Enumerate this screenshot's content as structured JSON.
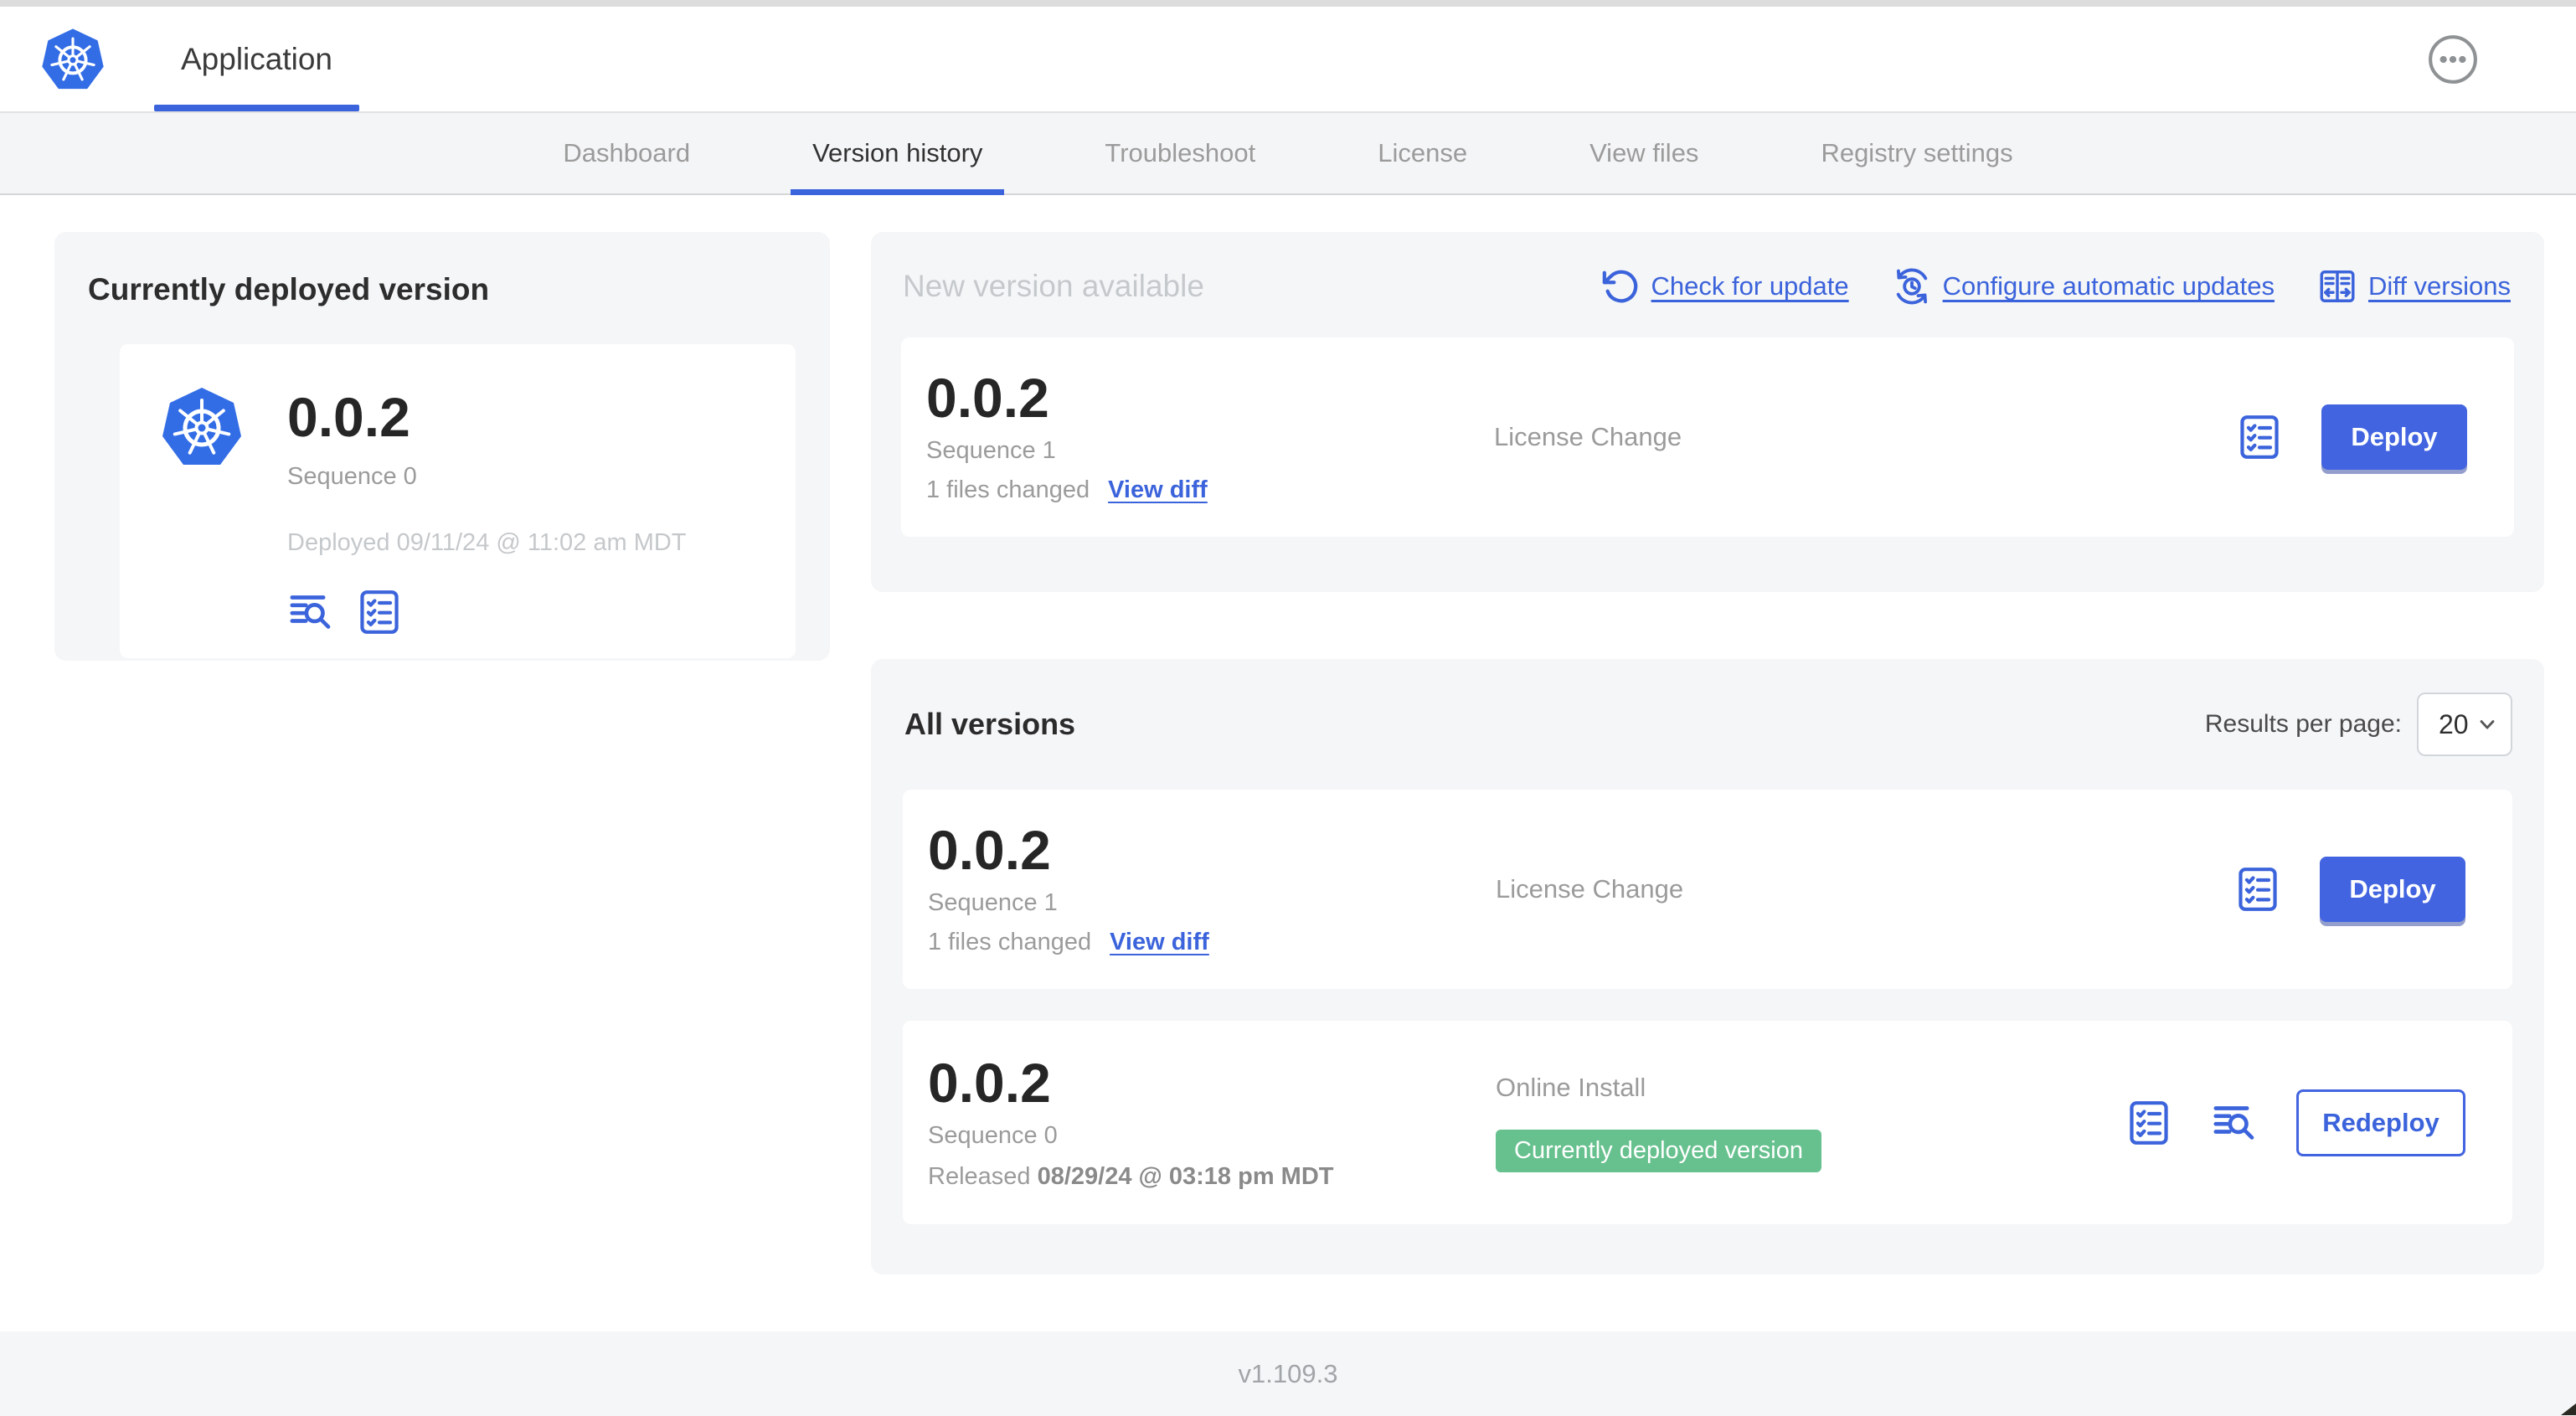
{
  "app": {
    "title": "Application"
  },
  "nav": {
    "tabs": [
      "Dashboard",
      "Version history",
      "Troubleshoot",
      "License",
      "View files",
      "Registry settings"
    ],
    "active": "Version history"
  },
  "current": {
    "section_title": "Currently deployed version",
    "version": "0.0.2",
    "sequence": "Sequence 0",
    "deployed": "Deployed 09/11/24 @ 11:02 am MDT"
  },
  "new_version": {
    "section_title": "New version available",
    "check_for_update": "Check for update",
    "configure_updates": "Configure automatic updates",
    "diff_versions": "Diff versions",
    "card": {
      "version": "0.0.2",
      "sequence": "Sequence 1",
      "files_changed": "1 files changed",
      "view_diff": "View diff",
      "release_notes": "License Change",
      "action": "Deploy"
    }
  },
  "all_versions": {
    "section_title": "All versions",
    "results_per_page_label": "Results per page:",
    "results_per_page": "20",
    "rows": [
      {
        "version": "0.0.2",
        "sequence": "Sequence 1",
        "files_changed": "1 files changed",
        "view_diff": "View diff",
        "release_notes": "License Change",
        "action": "Deploy"
      },
      {
        "version": "0.0.2",
        "sequence": "Sequence 0",
        "released_prefix": "Released ",
        "released_date": "08/29/24 @ 03:18 pm MDT",
        "release_notes": "Online Install",
        "badge": "Currently deployed version",
        "action": "Redeploy"
      }
    ]
  },
  "footer": {
    "app_version": "v1.109.3"
  },
  "colors": {
    "logo_blue": "#326de6",
    "accent_blue": "#3b63db",
    "button_blue": "#4264e0",
    "badge_green": "#67c18e",
    "muted_gray": "#9b9b9b",
    "section_bg": "#f5f6f8"
  }
}
